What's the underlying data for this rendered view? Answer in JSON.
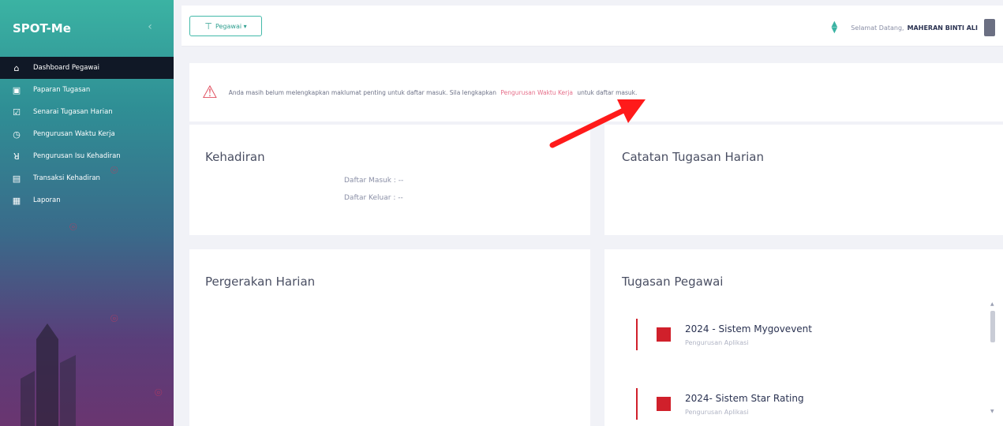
{
  "sidebar": {
    "logo": "SPOT-Me",
    "collapse_icon": "chevron-left-icon",
    "items": [
      {
        "label": "Dashboard Pegawai",
        "icon": "home-icon",
        "active": true
      },
      {
        "label": "Paparan Tugasan",
        "icon": "briefcase-icon",
        "active": false
      },
      {
        "label": "Senarai Tugasan Harian",
        "icon": "checklist-icon",
        "active": false
      },
      {
        "label": "Pengurusan Waktu Kerja",
        "icon": "clock-icon",
        "active": false
      },
      {
        "label": "Pengurusan Isu Kehadiran",
        "icon": "user-icon",
        "active": false
      },
      {
        "label": "Transaksi Kehadiran",
        "icon": "card-icon",
        "active": false
      },
      {
        "label": "Laporan",
        "icon": "report-icon",
        "active": false
      }
    ]
  },
  "topbar": {
    "role_button": "Pegawai ▾",
    "greeting": "Selamat Datang,",
    "user_name": "MAHERAN BINTI ALI"
  },
  "alert": {
    "text_before": "Anda masih belum melengkapkan maklumat penting untuk daftar masuk. Sila lengkapkan",
    "link": "Pengurusan Waktu Kerja",
    "text_after": "untuk daftar masuk."
  },
  "kehadiran": {
    "title": "Kehadiran",
    "daftar_masuk_label": "Daftar Masuk : --",
    "daftar_keluar_label": "Daftar Keluar : --"
  },
  "catatan": {
    "title": "Catatan Tugasan Harian"
  },
  "pergerakan": {
    "title": "Pergerakan Harian"
  },
  "tugasan": {
    "title": "Tugasan Pegawai",
    "items": [
      {
        "name": "2024 - Sistem Mygovevent",
        "sub": "Pengurusan Aplikasi"
      },
      {
        "name": "2024- Sistem Star Rating",
        "sub": "Pengurusan Aplikasi"
      }
    ]
  },
  "colors": {
    "accent": "#3bb3a3",
    "task_red": "#d0202b",
    "alert_red": "#e04f5f"
  }
}
